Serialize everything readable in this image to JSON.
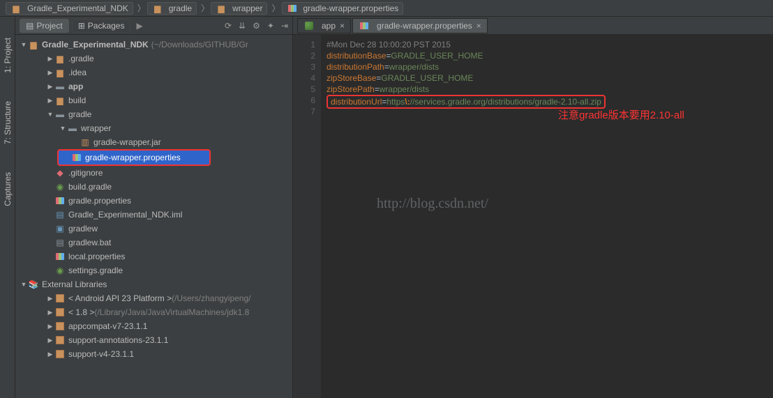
{
  "breadcrumb": [
    {
      "label": "Gradle_Experimental_NDK",
      "icon": "folder"
    },
    {
      "label": "gradle",
      "icon": "folder"
    },
    {
      "label": "wrapper",
      "icon": "folder"
    },
    {
      "label": "gradle-wrapper.properties",
      "icon": "properties"
    }
  ],
  "left_strip": {
    "item1": "1: Project",
    "item2": "7: Structure",
    "item3": "Captures"
  },
  "project_panel": {
    "tab_project": "Project",
    "tab_packages": "Packages",
    "tools": [
      "⟳",
      "⚙",
      "✦",
      "⇥"
    ]
  },
  "tree": {
    "root": {
      "name": "Gradle_Experimental_NDK",
      "hint": "(~/Downloads/GITHUB/Gr"
    },
    "items": [
      {
        "depth": 1,
        "twisty": "▶",
        "icon": "folder-closed",
        "name": ".gradle"
      },
      {
        "depth": 1,
        "twisty": "▶",
        "icon": "folder-closed",
        "name": ".idea"
      },
      {
        "depth": 1,
        "twisty": "▶",
        "icon": "folder-open-bold",
        "name": "app",
        "bold": true
      },
      {
        "depth": 1,
        "twisty": "▶",
        "icon": "folder-closed",
        "name": "build"
      },
      {
        "depth": 1,
        "twisty": "▼",
        "icon": "folder-open",
        "name": "gradle"
      },
      {
        "depth": 2,
        "twisty": "▼",
        "icon": "folder-open",
        "name": "wrapper"
      },
      {
        "depth": 3,
        "twisty": "",
        "icon": "jar",
        "name": "gradle-wrapper.jar"
      },
      {
        "depth": 3,
        "twisty": "",
        "icon": "properties",
        "name": "gradle-wrapper.properties",
        "selected": true
      },
      {
        "depth": 1,
        "twisty": "",
        "icon": "gitignore",
        "name": ".gitignore"
      },
      {
        "depth": 1,
        "twisty": "",
        "icon": "gradle",
        "name": "build.gradle"
      },
      {
        "depth": 1,
        "twisty": "",
        "icon": "properties",
        "name": "gradle.properties"
      },
      {
        "depth": 1,
        "twisty": "",
        "icon": "iml",
        "name": "Gradle_Experimental_NDK.iml"
      },
      {
        "depth": 1,
        "twisty": "",
        "icon": "sh",
        "name": "gradlew"
      },
      {
        "depth": 1,
        "twisty": "",
        "icon": "text",
        "name": "gradlew.bat"
      },
      {
        "depth": 1,
        "twisty": "",
        "icon": "properties",
        "name": "local.properties"
      },
      {
        "depth": 1,
        "twisty": "",
        "icon": "gradle",
        "name": "settings.gradle"
      }
    ],
    "ext_lib_label": "External Libraries",
    "ext_libs": [
      {
        "name": "< Android API 23 Platform >",
        "hint": "(/Users/zhangyipeng/"
      },
      {
        "name": "< 1.8 >",
        "hint": "(/Library/Java/JavaVirtualMachines/jdk1.8"
      },
      {
        "name": "appcompat-v7-23.1.1",
        "hint": ""
      },
      {
        "name": "support-annotations-23.1.1",
        "hint": ""
      },
      {
        "name": "support-v4-23.1.1",
        "hint": ""
      }
    ]
  },
  "editor": {
    "tabs": [
      {
        "label": "app",
        "icon": "app"
      },
      {
        "label": "gradle-wrapper.properties",
        "icon": "properties"
      }
    ],
    "line_numbers": [
      "1",
      "2",
      "3",
      "4",
      "5",
      "6",
      "7"
    ],
    "code": {
      "l1_comment": "#Mon Dec 28 10:00:20 PST 2015",
      "l2_key": "distributionBase",
      "l2_val": "GRADLE_USER_HOME",
      "l3_key": "distributionPath",
      "l3_val": "wrapper/dists",
      "l4_key": "zipStoreBase",
      "l4_val": "GRADLE_USER_HOME",
      "l5_key": "zipStorePath",
      "l5_val": "wrapper/dists",
      "l6_key": "distributionUrl",
      "l6_val_a": "https",
      "l6_esc": "\\:",
      "l6_val_b": "//services.gradle.org/distributions/gradle-2.10-all.zip"
    },
    "annotation": "注意gradle版本要用2.10-all",
    "watermark": "http://blog.csdn.net/"
  }
}
